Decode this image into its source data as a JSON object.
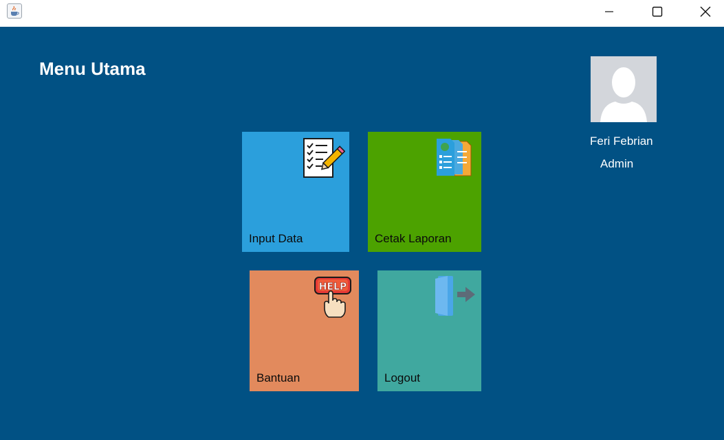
{
  "window": {
    "icon": "java-coffee-cup-icon",
    "controls": [
      "minimize-icon",
      "maximize-icon",
      "close-icon"
    ]
  },
  "header": {
    "title": "Menu Utama"
  },
  "user": {
    "name": "Feri Febrian",
    "role": "Admin",
    "avatar": "default-user-silhouette"
  },
  "tiles": [
    {
      "label": "Input Data",
      "icon": "checklist-pencil-icon",
      "color": "#2b9fdc"
    },
    {
      "label": "Cetak Laporan",
      "icon": "report-documents-icon",
      "color": "#4ca200"
    },
    {
      "label": "Bantuan",
      "icon": "help-button-icon",
      "color": "#e28a5d"
    },
    {
      "label": "Logout",
      "icon": "door-exit-icon",
      "color": "#40a89f"
    }
  ],
  "colors": {
    "background": "#015184",
    "titlebar": "#ffffff",
    "text": "#ffffff"
  }
}
